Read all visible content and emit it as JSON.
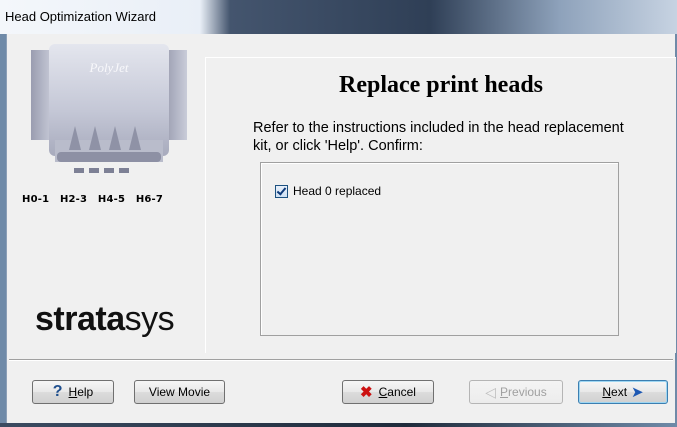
{
  "window": {
    "title": "Head Optimization Wizard"
  },
  "illustration": {
    "brand_on_head": "PolyJet",
    "head_labels": [
      "H0-1",
      "H2-3",
      "H4-5",
      "H6-7"
    ]
  },
  "logo": {
    "bold_part": "strata",
    "thin_part": "sys"
  },
  "page": {
    "heading": "Replace print heads",
    "instructions": "Refer to the instructions included in the head replacement kit, or click 'Help'. Confirm:",
    "checkbox": {
      "label": "Head 0 replaced",
      "checked": true
    }
  },
  "buttons": {
    "help": {
      "label_u": "H",
      "label_rest": "elp",
      "icon": "question-icon"
    },
    "view_movie": {
      "label": "View Movie"
    },
    "cancel": {
      "label_u": "C",
      "label_rest": "ancel",
      "icon": "red-x-icon"
    },
    "previous": {
      "label_u": "P",
      "label_rest": "revious",
      "enabled": false,
      "icon": "back-arrow-icon"
    },
    "next": {
      "label_u": "N",
      "label_rest": "ext",
      "icon": "forward-arrow-icon"
    }
  },
  "colors": {
    "title_bar_dark": "#2f3f56",
    "cancel_x": "#cc1111",
    "next_arrow": "#1d58b3"
  }
}
